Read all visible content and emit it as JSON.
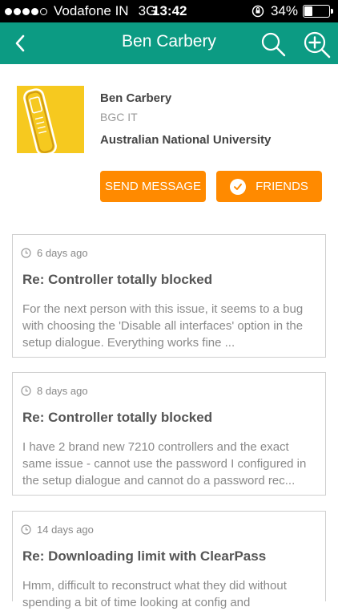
{
  "status_bar": {
    "carrier": "Vodafone IN",
    "network": "3G",
    "time": "13:42",
    "battery_percent": "34%",
    "battery_level": 0.34,
    "signal_bars_filled": 4,
    "signal_bars_total": 5
  },
  "nav": {
    "title": "Ben Carbery",
    "back_icon": "chevron-left-icon",
    "search_icon": "search-icon",
    "add_icon": "zoom-in-plus-icon"
  },
  "profile": {
    "name": "Ben Carbery",
    "department": "BGC IT",
    "organization": "Australian National University",
    "send_message_label": "SEND MESSAGE",
    "friends_label": "FRIENDS",
    "accent_color": "#ff8a00"
  },
  "posts": [
    {
      "time": "6 days ago",
      "title": "Re: Controller totally blocked",
      "excerpt": "For the next person with this issue, it seems to a bug with choosing the 'Disable all interfaces' option in the setup dialogue. Everything works fine ..."
    },
    {
      "time": "8 days ago",
      "title": "Re: Controller totally blocked",
      "excerpt": "I have 2 brand new 7210 controllers and the exact same issue - cannot use the password I configured in the setup dialogue and cannot do a password rec..."
    },
    {
      "time": "14 days ago",
      "title": "Re: Downloading limit with ClearPass",
      "excerpt": "Hmm, difficult to reconstruct what they did without spending a bit of time looking at config and"
    }
  ],
  "colors": {
    "nav_background": "#0c9b83",
    "button_orange": "#ff8a00",
    "card_border": "#cfcfcf"
  }
}
